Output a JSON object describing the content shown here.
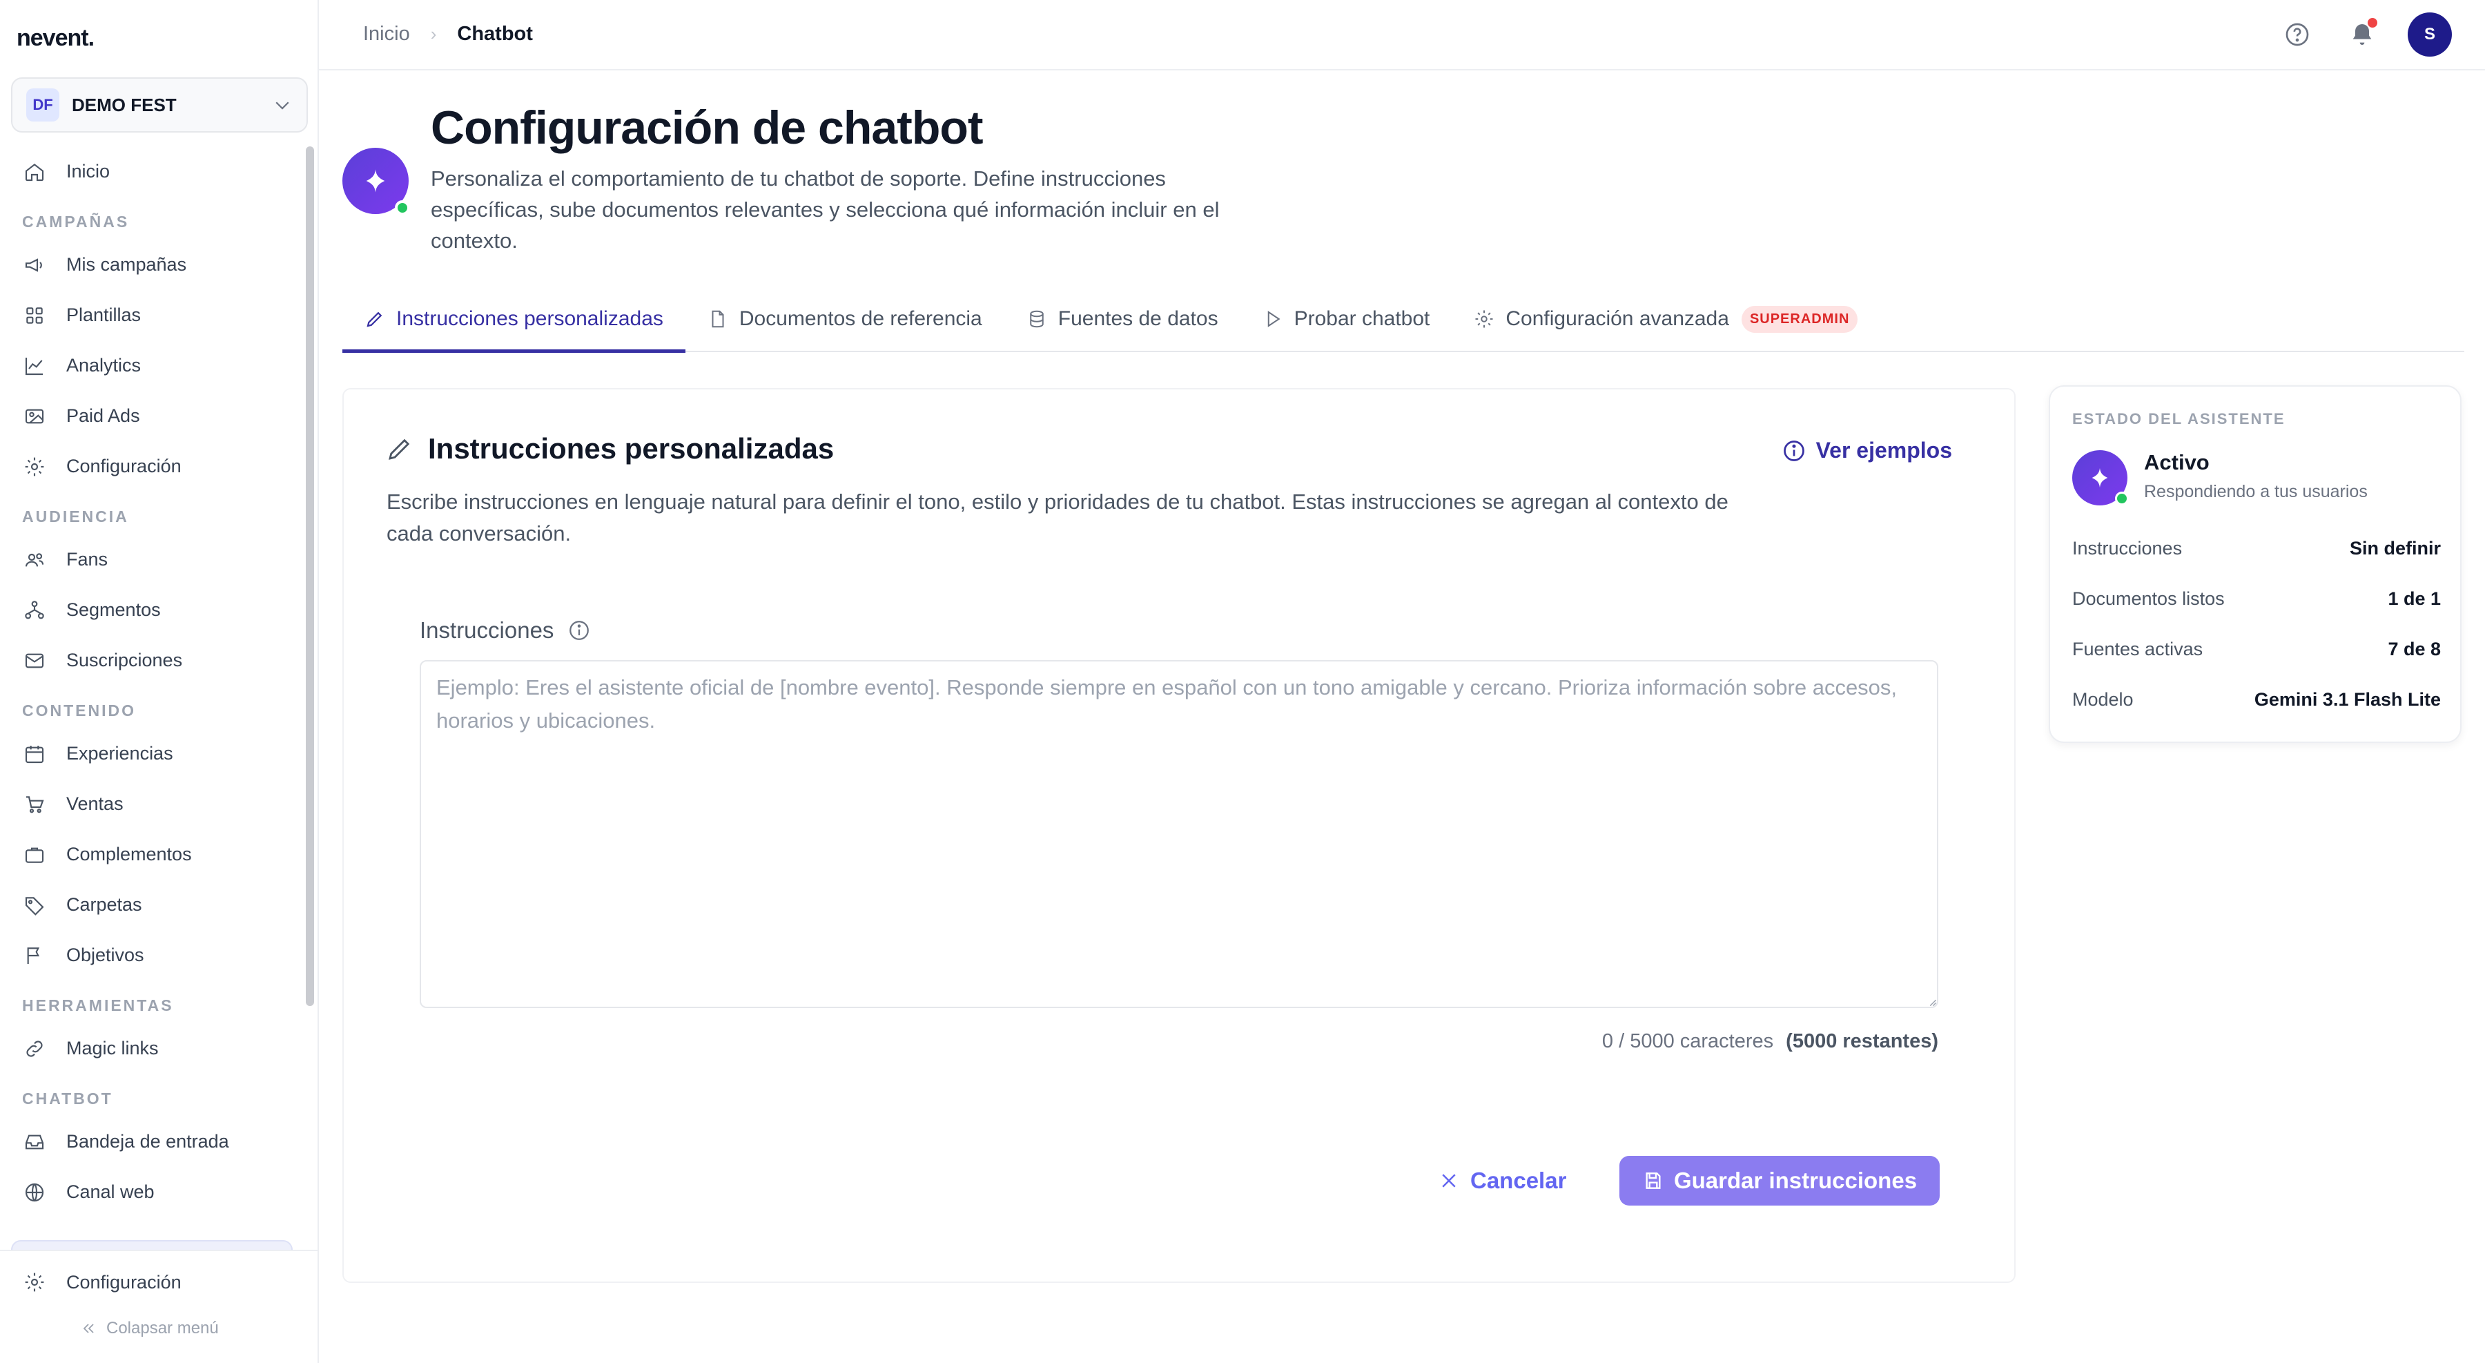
{
  "app": {
    "logo": "nevent."
  },
  "org": {
    "initials": "DF",
    "name": "DEMO FEST"
  },
  "sidebar": {
    "home": "Inicio",
    "sections": [
      {
        "title": "CAMPAÑAS",
        "items": [
          {
            "label": "Mis campañas",
            "icon": "megaphone-icon"
          },
          {
            "label": "Plantillas",
            "icon": "grid-icon"
          },
          {
            "label": "Analytics",
            "icon": "chart-line-icon"
          },
          {
            "label": "Paid Ads",
            "icon": "image-icon"
          },
          {
            "label": "Configuración",
            "icon": "gear-icon"
          }
        ]
      },
      {
        "title": "AUDIENCIA",
        "items": [
          {
            "label": "Fans",
            "icon": "users-icon"
          },
          {
            "label": "Segmentos",
            "icon": "hierarchy-icon"
          },
          {
            "label": "Suscripciones",
            "icon": "mail-icon"
          }
        ]
      },
      {
        "title": "CONTENIDO",
        "items": [
          {
            "label": "Experiencias",
            "icon": "calendar-icon"
          },
          {
            "label": "Ventas",
            "icon": "cart-icon"
          },
          {
            "label": "Complementos",
            "icon": "briefcase-icon"
          },
          {
            "label": "Carpetas",
            "icon": "tag-icon"
          },
          {
            "label": "Objetivos",
            "icon": "flag-icon"
          }
        ]
      },
      {
        "title": "HERRAMIENTAS",
        "items": [
          {
            "label": "Magic links",
            "icon": "link-icon"
          }
        ]
      },
      {
        "title": "CHATBOT",
        "items": [
          {
            "label": "Bandeja de entrada",
            "icon": "inbox-icon"
          },
          {
            "label": "Canal web",
            "icon": "globe-icon"
          }
        ]
      }
    ],
    "footer_settings": "Configuración",
    "collapse": "Colapsar menú"
  },
  "topbar": {
    "breadcrumb_home": "Inicio",
    "breadcrumb_current": "Chatbot",
    "avatar_initial": "S"
  },
  "header": {
    "title": "Configuración de chatbot",
    "description": "Personaliza el comportamiento de tu chatbot de soporte. Define instrucciones específicas, sube documentos relevantes y selecciona qué información incluir en el contexto."
  },
  "tabs": [
    {
      "label": "Instrucciones personalizadas",
      "icon": "pencil-icon",
      "active": true
    },
    {
      "label": "Documentos de referencia",
      "icon": "document-icon"
    },
    {
      "label": "Fuentes de datos",
      "icon": "database-icon"
    },
    {
      "label": "Probar chatbot",
      "icon": "play-icon"
    },
    {
      "label": "Configuración avanzada",
      "icon": "gear-icon",
      "badge": "SUPERADMIN"
    }
  ],
  "instructions": {
    "title": "Instrucciones personalizadas",
    "examples_link": "Ver ejemplos",
    "description": "Escribe instrucciones en lenguaje natural para definir el tono, estilo y prioridades de tu chatbot. Estas instrucciones se agregan al contexto de cada conversación.",
    "field_label": "Instrucciones",
    "value": "",
    "placeholder": "Ejemplo: Eres el asistente oficial de [nombre evento]. Responde siempre en español con un tono amigable y cercano. Prioriza información sobre accesos, horarios y ubicaciones.",
    "counter": "0 / 5000 caracteres",
    "remaining": "(5000 restantes)",
    "cancel_label": "Cancelar",
    "save_label": "Guardar instrucciones"
  },
  "status": {
    "title": "ESTADO DEL ASISTENTE",
    "state": "Activo",
    "state_sub": "Respondiendo a tus usuarios",
    "rows": [
      {
        "label": "Instrucciones",
        "value": "Sin definir"
      },
      {
        "label": "Documentos listos",
        "value": "1 de 1"
      },
      {
        "label": "Fuentes activas",
        "value": "7 de 8"
      },
      {
        "label": "Modelo",
        "value": "Gemini 3.1 Flash Lite"
      }
    ]
  },
  "colors": {
    "primary": "#3730a3",
    "accent_gradient_start": "#5b3fd8",
    "save_button": "#8b7cf0",
    "online": "#22c55e",
    "badge_text": "#dc2626"
  }
}
